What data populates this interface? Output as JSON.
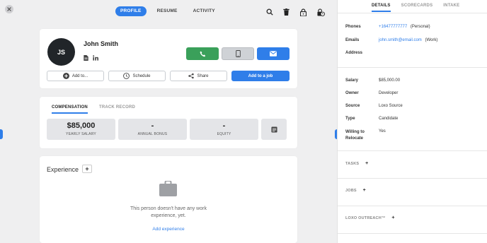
{
  "header": {
    "tabs": [
      {
        "label": "PROFILE",
        "active": true
      },
      {
        "label": "RESUME",
        "active": false
      },
      {
        "label": "ACTIVITY",
        "active": false
      }
    ],
    "icons": [
      "search-icon",
      "trash-icon",
      "lock-icon",
      "lock-clock-icon"
    ]
  },
  "profile": {
    "initials": "JS",
    "name": "John Smith",
    "actions": {
      "add_to": "Add to...",
      "schedule": "Schedule",
      "share": "Share",
      "add_to_job": "Add to a job"
    }
  },
  "compensation": {
    "tabs": [
      "COMPENSATION",
      "TRACK RECORD"
    ],
    "metrics": [
      {
        "value": "$85,000",
        "label": "YEARLY SALARY"
      },
      {
        "value": "-",
        "label": "ANNUAL BONUS"
      },
      {
        "value": "-",
        "label": "EQUITY"
      }
    ]
  },
  "experience": {
    "title": "Experience",
    "empty_text_1": "This person doesn't have any work",
    "empty_text_2": "experience, yet.",
    "add_link": "Add experience"
  },
  "details": {
    "tabs": [
      "DETAILS",
      "SCORECARDS",
      "INTAKE"
    ],
    "phones_label": "Phones",
    "phone_value": "+16477777777",
    "phone_type": "(Personal)",
    "emails_label": "Emails",
    "email_value": "john.smith@email.com",
    "email_type": "(Work)",
    "address_label": "Address",
    "fields": [
      {
        "label": "Salary",
        "value": "$85,000.00"
      },
      {
        "label": "Owner",
        "value": "Developer"
      },
      {
        "label": "Source",
        "value": "Loxo Source"
      },
      {
        "label": "Type",
        "value": "Candidate"
      }
    ],
    "relocate_label_1": "Willing to",
    "relocate_label_2": "Relocate",
    "relocate_value": "Yes",
    "sections": [
      "TASKS",
      "JOBS",
      "LOXO OUTREACH™"
    ]
  },
  "colors": {
    "accent": "#2f7ee9",
    "call": "#3aa05a",
    "avatar": "#212529"
  }
}
